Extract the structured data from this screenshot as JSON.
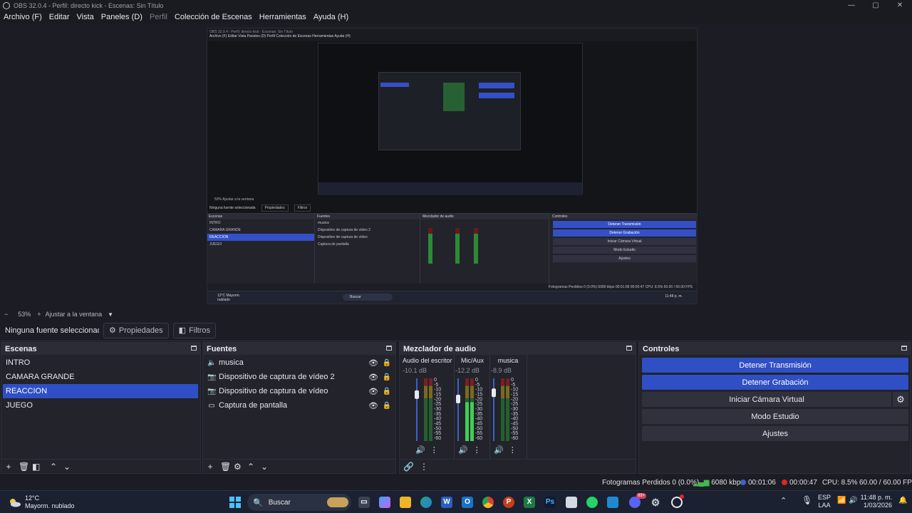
{
  "window": {
    "title": "OBS 32.0.4 - Perfil: directo kick - Escenas: Sin Título",
    "controls": [
      "—",
      "▢",
      "✕"
    ]
  },
  "menu": [
    {
      "label": "Archivo (F)",
      "enabled": true
    },
    {
      "label": "Editar",
      "enabled": true
    },
    {
      "label": "Vista",
      "enabled": true
    },
    {
      "label": "Paneles (D)",
      "enabled": true
    },
    {
      "label": "Perfil",
      "enabled": false
    },
    {
      "label": "Colección de Escenas",
      "enabled": true
    },
    {
      "label": "Herramientas",
      "enabled": true
    },
    {
      "label": "Ayuda (H)",
      "enabled": true
    }
  ],
  "zoom": {
    "minus": "−",
    "level": "53%",
    "plus": "+",
    "fit": "Ajustar a la ventana"
  },
  "source_toolbar": {
    "no_source": "Ninguna fuente seleccionada",
    "properties": "Propiedades",
    "filters": "Filtros"
  },
  "scenes": {
    "title": "Escenas",
    "items": [
      "INTRO",
      "CAMARA GRANDE",
      "REACCION",
      "JUEGO"
    ],
    "selected": "REACCION"
  },
  "sources": {
    "title": "Fuentes",
    "items": [
      {
        "label": "musica",
        "icon": "speaker-icon"
      },
      {
        "label": "Dispositivo de captura de vídeo 2",
        "icon": "camera-icon"
      },
      {
        "label": "Dispositivo de captura de vídeo",
        "icon": "camera-icon"
      },
      {
        "label": "Captura de pantalla",
        "icon": "monitor-icon"
      }
    ]
  },
  "mixer": {
    "title": "Mezclador de audio",
    "scale": [
      "0",
      "-5",
      "-10",
      "-15",
      "-20",
      "-25",
      "-30",
      "-35",
      "-40",
      "-45",
      "-50",
      "-55",
      "-60"
    ],
    "channels": [
      {
        "name": "Audio del escritorio",
        "db": "-10.1 dB",
        "volume": 0.74,
        "level": 0
      },
      {
        "name": "Mic/Aux",
        "db": "-12.2 dB",
        "volume": 0.67,
        "level": 0.62
      },
      {
        "name": "musica",
        "db": "-8.9 dB",
        "volume": 0.77,
        "level": 0
      }
    ]
  },
  "controls": {
    "title": "Controles",
    "stop_stream": "Detener Transmisión",
    "stop_record": "Detener Grabación",
    "virtual_cam": "Iniciar Cámara Virtual",
    "studio_mode": "Modo Estudio",
    "settings": "Ajustes"
  },
  "status": {
    "dropped": "Fotogramas Perdidos 0 (0.0%)",
    "bitrate": "6080 kbps",
    "stream_time": "00:01:06",
    "record_time": "00:00:47",
    "cpu": "CPU: 8.5%",
    "fps": "60.00 / 60.00 FPS"
  },
  "preview": {
    "mini_title": "OBS 32.0.4 - Perfil: directo kick - Escenas: Sin Título",
    "mini_menu": "Archivo (F)   Editar   Vista   Paneles (D)   Perfil   Colección de Escenas   Herramientas   Ayuda (H)",
    "mini_zoom": "53%     Ajustar a la ventana",
    "mini_nosrc": "Ninguna fuente seleccionada",
    "mini_props": "Propiedades",
    "mini_filters": "Filtros",
    "mini_scenes": "Escenas",
    "mini_sources": "Fuentes",
    "mini_mixer": "Mezclador de audio",
    "mini_controls": "Controles",
    "mini_status": "Fotogramas Perdidos 0 (0.0%)   6080 kbps   00:01:08   00:00:47   CPU: 8.5%   60.00 / 60.00 FPS",
    "mini_weather": "12°C Mayorm. nublado",
    "mini_search": "Buscar",
    "mini_time": "11:48 p. m."
  },
  "taskbar": {
    "temp": "12°C",
    "weather": "Mayorm. nublado",
    "search": "Buscar",
    "lang1": "ESP",
    "lang2": "LAA",
    "time": "11:48 p. m.",
    "date": "1/03/2026",
    "badge": "99+"
  }
}
